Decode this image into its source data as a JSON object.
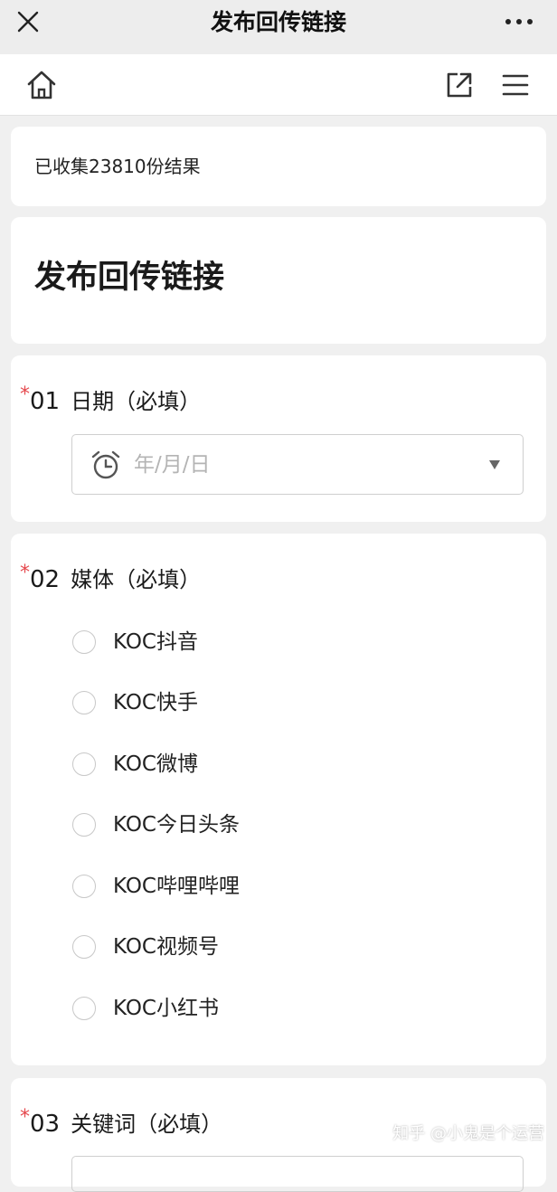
{
  "titlebar": {
    "close_icon": "close-icon",
    "title": "发布回传链接",
    "more_icon": "more-dots-icon"
  },
  "navbar": {
    "home_icon": "home-icon",
    "share_icon": "external-link-icon",
    "menu_icon": "hamburger-menu-icon"
  },
  "summary": {
    "count_text": "已收集23810份结果"
  },
  "form": {
    "title": "发布回传链接",
    "questions": [
      {
        "required_mark": "*",
        "number": "01",
        "label": "日期（必填）",
        "type": "date",
        "placeholder": "年/月/日",
        "icon": "alarm-clock-icon"
      },
      {
        "required_mark": "*",
        "number": "02",
        "label": "媒体（必填）",
        "type": "radio",
        "options": [
          "KOC抖音",
          "KOC快手",
          "KOC微博",
          "KOC今日头条",
          "KOC哔哩哔哩",
          "KOC视频号",
          "KOC小红书"
        ]
      },
      {
        "required_mark": "*",
        "number": "03",
        "label": "关键词（必填）",
        "type": "text"
      }
    ]
  },
  "watermark": "知乎 @小鬼是个运营",
  "colors": {
    "required": "#e5484d",
    "placeholder": "#b4b4b4",
    "background": "#f0f0f0"
  }
}
